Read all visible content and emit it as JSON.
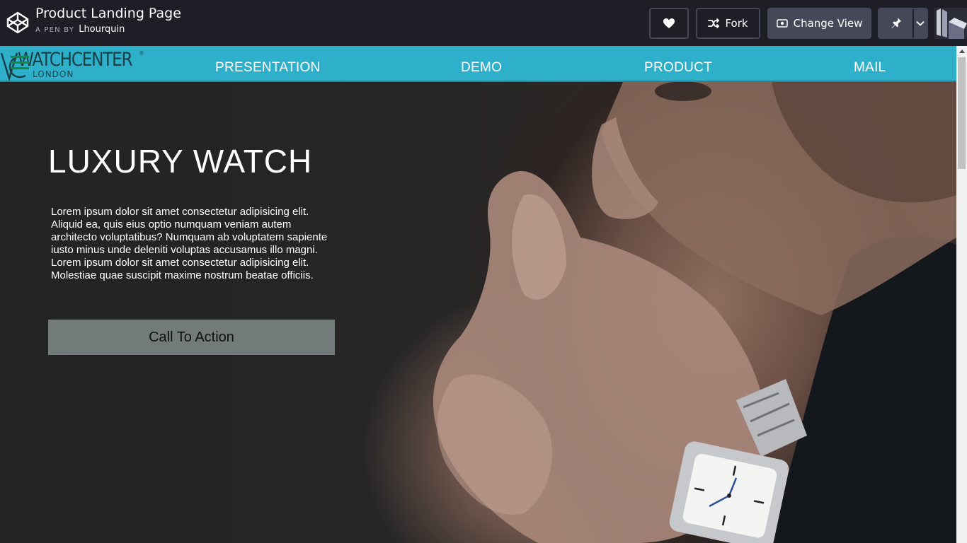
{
  "codepen": {
    "title": "Product Landing Page",
    "byline_prefix": "A PEN BY",
    "author": "Lhourquin",
    "fork_label": "Fork",
    "change_view_label": "Change View"
  },
  "site": {
    "brand_name": "WATCHCENTER",
    "brand_reg": "®",
    "brand_sub": "LONDON",
    "nav": [
      "PRESENTATION",
      "DEMO",
      "PRODUCT",
      "MAIL"
    ],
    "hero_title": "LUXURY WATCH",
    "hero_text": "Lorem ipsum dolor sit amet consectetur adipisicing elit. Aliquid ea, quis eius optio numquam veniam autem architecto voluptatibus? Numquam ab voluptatem sapiente iusto minus unde deleniti voluptas accusamus illo magni. Lorem ipsum dolor sit amet consectetur adipisicing elit. Molestiae quae suscipit maxime nostrum beatae officiis.",
    "cta_label": "Call To Action"
  },
  "colors": {
    "codepen_bar": "#1e1f26",
    "codepen_button": "#444857",
    "nav_background": "#2fb0ca",
    "cta_background": "#727b7a",
    "menu_icon": "#118a3b"
  },
  "icons": {
    "codepen_logo": "codepen-logo-icon",
    "heart": "heart-icon",
    "fork": "fork-icon",
    "change_view": "eye-icon",
    "pin": "pin-icon",
    "caret": "chevron-down-icon",
    "menu": "hamburger-menu-icon",
    "scroll_up": "scroll-up-arrow-icon"
  }
}
